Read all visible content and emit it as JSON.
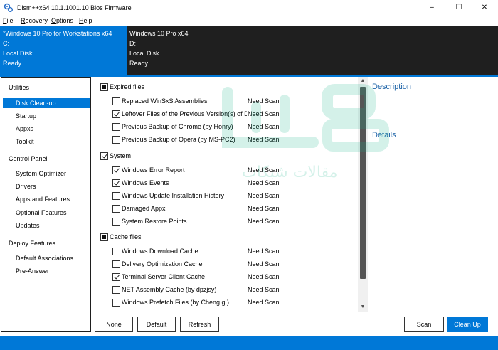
{
  "window": {
    "title": "Dism++x64 10.1.1001.10 Bios Firmware",
    "controls": {
      "minimize": "–",
      "maximize": "☐",
      "close": "✕"
    },
    "app_icon": "gear-cluster-icon"
  },
  "menu": [
    "File",
    "Recovery",
    "Options",
    "Help"
  ],
  "banner": {
    "left": [
      "*Windows 10 Pro for Workstations x64",
      "C:",
      "Local Disk",
      "Ready"
    ],
    "right": [
      "Windows 10 Pro x64",
      "D:",
      "Local Disk",
      "Ready"
    ],
    "accent": "#0078d7",
    "dark": "#1f1f1f"
  },
  "sidebar": {
    "groups": [
      {
        "label": "Utilities",
        "items": [
          "Disk Clean-up",
          "Startup",
          "Appxs",
          "Toolkit"
        ]
      },
      {
        "label": "Control Panel",
        "items": [
          "System Optimizer",
          "Drivers",
          "Apps and Features",
          "Optional Features",
          "Updates"
        ]
      },
      {
        "label": "Deploy Features",
        "items": [
          "Default Associations",
          "Pre-Answer"
        ]
      }
    ],
    "active": "Disk Clean-up"
  },
  "cleanup": {
    "sections": [
      {
        "title": "Expired files",
        "state": "partial",
        "items": [
          {
            "label": "Replaced WinSxS Assemblies",
            "checked": false,
            "status": "Need Scan"
          },
          {
            "label": "Leftover Files of the Previous Version(s) of Dism",
            "checked": true,
            "status": "Need Scan"
          },
          {
            "label": "Previous Backup of Chrome (by Honry)",
            "checked": false,
            "status": "Need Scan"
          },
          {
            "label": "Previous Backup of Opera (by MS-PC2)",
            "checked": false,
            "status": "Need Scan"
          }
        ]
      },
      {
        "title": "System",
        "state": "checked",
        "items": [
          {
            "label": "Windows Error Report",
            "checked": true,
            "status": "Need Scan"
          },
          {
            "label": "Windows Events",
            "checked": true,
            "status": "Need Scan"
          },
          {
            "label": "Windows Update Installation History",
            "checked": false,
            "status": "Need Scan"
          },
          {
            "label": "Damaged Appx",
            "checked": false,
            "status": "Need Scan"
          },
          {
            "label": "System Restore Points",
            "checked": false,
            "status": "Need Scan"
          }
        ]
      },
      {
        "title": "Cache files",
        "state": "partial",
        "items": [
          {
            "label": "Windows Download Cache",
            "checked": false,
            "status": "Need Scan"
          },
          {
            "label": "Delivery Optimization Cache",
            "checked": false,
            "status": "Need Scan"
          },
          {
            "label": "Terminal Server Client Cache",
            "checked": true,
            "status": "Need Scan"
          },
          {
            "label": "NET Assembly Cache (by dpzjsy)",
            "checked": false,
            "status": "Need Scan"
          },
          {
            "label": "Windows Prefetch Files (by Cheng g.)",
            "checked": false,
            "status": "Need Scan"
          }
        ]
      }
    ]
  },
  "details_panel": {
    "description": "Description",
    "details": "Details"
  },
  "buttons": {
    "none": "None",
    "default": "Default",
    "refresh": "Refresh",
    "scan": "Scan",
    "clean_up": "Clean Up"
  },
  "watermark": {
    "text": "مقالات شبكات",
    "color": "#18b38c"
  }
}
